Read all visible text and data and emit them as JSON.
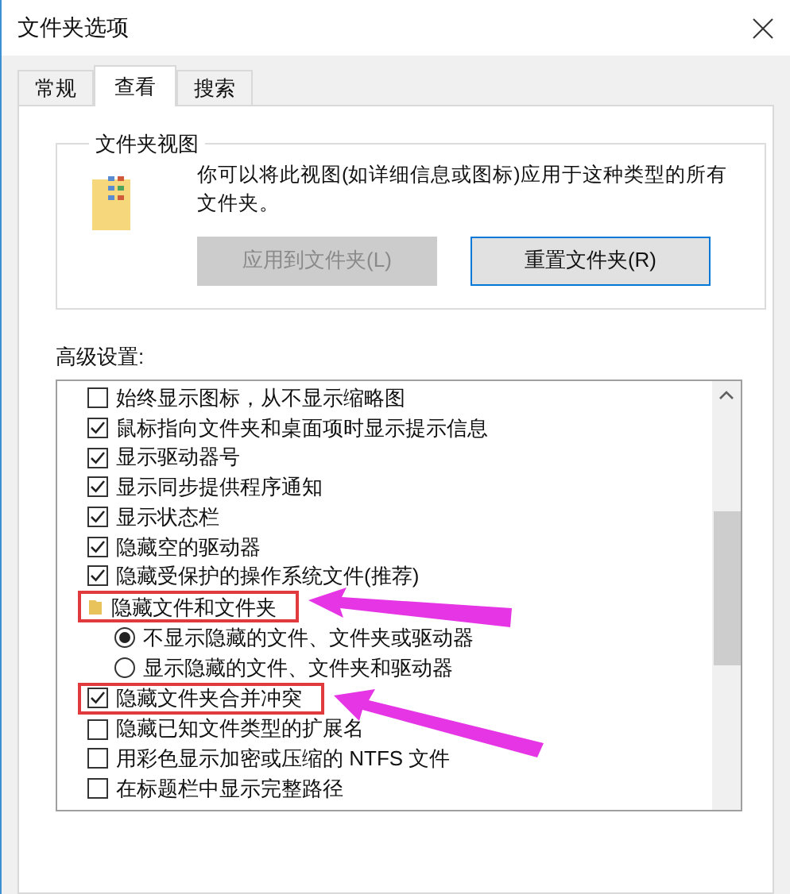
{
  "window": {
    "title": "文件夹选项"
  },
  "tabs": [
    {
      "label": "常规",
      "selected": false
    },
    {
      "label": "查看",
      "selected": true
    },
    {
      "label": "搜索",
      "selected": false
    }
  ],
  "folder_views": {
    "title": "文件夹视图",
    "description": "你可以将此视图(如详细信息或图标)应用于这种类型的所有文件夹。",
    "buttons": [
      {
        "label": "应用到文件夹(L)",
        "disabled": true
      },
      {
        "label": "重置文件夹(R)",
        "disabled": false
      }
    ]
  },
  "advanced": {
    "label": "高级设置:",
    "items": [
      {
        "kind": "checkbox",
        "label": "始终显示图标，从不显示缩略图",
        "checked": false,
        "highlighted": false
      },
      {
        "kind": "checkbox",
        "label": "鼠标指向文件夹和桌面项时显示提示信息",
        "checked": true,
        "highlighted": false
      },
      {
        "kind": "checkbox",
        "label": "显示驱动器号",
        "checked": true,
        "highlighted": false
      },
      {
        "kind": "checkbox",
        "label": "显示同步提供程序通知",
        "checked": true,
        "highlighted": false
      },
      {
        "kind": "checkbox",
        "label": "显示状态栏",
        "checked": true,
        "highlighted": false
      },
      {
        "kind": "checkbox",
        "label": "隐藏空的驱动器",
        "checked": true,
        "highlighted": false
      },
      {
        "kind": "checkbox",
        "label": "隐藏受保护的操作系统文件(推荐)",
        "checked": true,
        "highlighted": false
      },
      {
        "kind": "folder",
        "label": "隐藏文件和文件夹",
        "highlighted": true,
        "children": [
          {
            "kind": "radio",
            "label": "不显示隐藏的文件、文件夹或驱动器",
            "selected": true
          },
          {
            "kind": "radio",
            "label": "显示隐藏的文件、文件夹和驱动器",
            "selected": false
          }
        ]
      },
      {
        "kind": "checkbox",
        "label": "隐藏文件夹合并冲突",
        "checked": true,
        "highlighted": true
      },
      {
        "kind": "checkbox",
        "label": "隐藏已知文件类型的扩展名",
        "checked": false,
        "highlighted": false
      },
      {
        "kind": "checkbox",
        "label": "用彩色显示加密或压缩的 NTFS 文件",
        "checked": false,
        "highlighted": false
      },
      {
        "kind": "checkbox",
        "label": "在标题栏中显示完整路径",
        "checked": false,
        "highlighted": false
      }
    ]
  }
}
